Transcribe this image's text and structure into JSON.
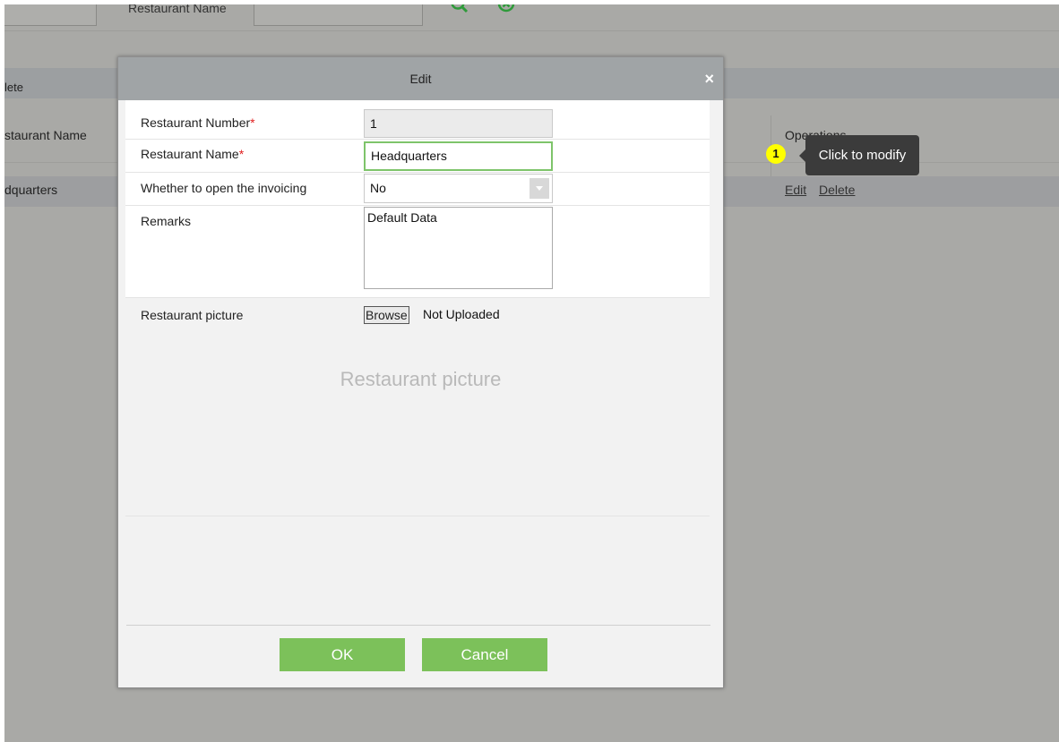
{
  "background": {
    "search": {
      "restaurant_name_label": "Restaurant Name",
      "restaurant_name_value": ""
    },
    "toolbar": {
      "delete_label": "lete"
    },
    "table": {
      "headers": {
        "name": "staurant Name",
        "operations": "Operations"
      },
      "rows": [
        {
          "name": "dquarters",
          "edit": "Edit",
          "delete": "Delete"
        }
      ]
    },
    "hint": {
      "badge": "1",
      "tooltip": "Click to modify"
    }
  },
  "dialog": {
    "title": "Edit",
    "close": "×",
    "fields": {
      "number": {
        "label": "Restaurant Number",
        "required": "*",
        "value": "1"
      },
      "name": {
        "label": "Restaurant Name",
        "required": "*",
        "value": "Headquarters"
      },
      "invoicing": {
        "label": "Whether to open the invoicing",
        "value": "No"
      },
      "remarks": {
        "label": "Remarks",
        "value": "Default Data"
      },
      "picture": {
        "label": "Restaurant picture",
        "browse": "Browse",
        "status": "Not Uploaded",
        "placeholder": "Restaurant picture"
      }
    },
    "buttons": {
      "ok": "OK",
      "cancel": "Cancel"
    }
  },
  "colors": {
    "overlay": "#a9a9a6",
    "accent_green": "#7cc15a",
    "title_bar": "#a0a4a6",
    "badge": "#ffff00"
  }
}
